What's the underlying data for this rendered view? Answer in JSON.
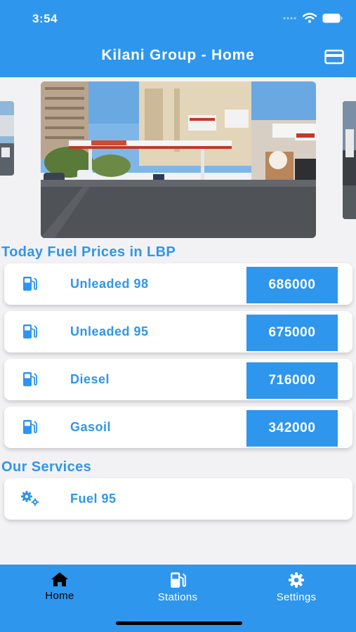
{
  "status_bar": {
    "time": "3:54",
    "icons": [
      "signal-dots-icon",
      "wifi-icon",
      "battery-icon"
    ]
  },
  "header": {
    "title": "Kilani Group - Home",
    "right_icon": "credit-card-icon"
  },
  "carousel": {
    "slides": [
      "gas-station-photo",
      "gas-station-photo",
      "gas-station-photo"
    ]
  },
  "fuel_prices": {
    "title": "Today Fuel Prices in LBP",
    "items": [
      {
        "name": "Unleaded 98",
        "price": "686000",
        "icon": "gas-pump-icon"
      },
      {
        "name": "Unleaded 95",
        "price": "675000",
        "icon": "gas-pump-icon"
      },
      {
        "name": "Diesel",
        "price": "716000",
        "icon": "gas-pump-icon"
      },
      {
        "name": "Gasoil",
        "price": "342000",
        "icon": "gas-pump-icon"
      }
    ]
  },
  "services": {
    "title": "Our Services",
    "items": [
      {
        "name": "Fuel 95",
        "icon": "gears-icon"
      }
    ]
  },
  "tabs": [
    {
      "label": "Home",
      "icon": "home-icon",
      "active": true
    },
    {
      "label": "Stations",
      "icon": "gas-pump-icon",
      "active": false
    },
    {
      "label": "Settings",
      "icon": "gear-icon",
      "active": false
    }
  ],
  "colors": {
    "primary": "#2e96ec",
    "background": "#f2f2f4",
    "card": "#ffffff",
    "active_tab_text": "#000000"
  }
}
